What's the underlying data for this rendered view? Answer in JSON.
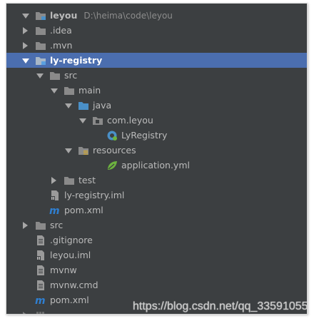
{
  "tree": {
    "rows": [
      {
        "label": "leyou",
        "path": "D:\\heima\\code\\leyou",
        "icon": "module-folder-icon",
        "arrow": "expanded",
        "bold": true
      },
      {
        "label": ".idea",
        "icon": "folder-icon",
        "arrow": "collapsed"
      },
      {
        "label": ".mvn",
        "icon": "folder-icon",
        "arrow": "collapsed"
      },
      {
        "label": "ly-registry",
        "icon": "module-folder-icon",
        "arrow": "expanded",
        "bold": true,
        "selected": true
      },
      {
        "label": "src",
        "icon": "folder-icon",
        "arrow": "expanded"
      },
      {
        "label": "main",
        "icon": "folder-icon",
        "arrow": "expanded"
      },
      {
        "label": "java",
        "icon": "source-folder-icon",
        "arrow": "expanded"
      },
      {
        "label": "com.leyou",
        "icon": "package-icon",
        "arrow": "expanded"
      },
      {
        "label": "LyRegistry",
        "icon": "spring-boot-class-icon",
        "arrow": "none"
      },
      {
        "label": "resources",
        "icon": "resources-folder-icon",
        "arrow": "expanded"
      },
      {
        "label": "application.yml",
        "icon": "spring-config-icon",
        "arrow": "none"
      },
      {
        "label": "test",
        "icon": "folder-icon",
        "arrow": "collapsed"
      },
      {
        "label": "ly-registry.iml",
        "icon": "iml-file-icon",
        "arrow": "none"
      },
      {
        "label": "pom.xml",
        "icon": "maven-icon",
        "arrow": "none"
      },
      {
        "label": "src",
        "icon": "folder-icon",
        "arrow": "collapsed"
      },
      {
        "label": ".gitignore",
        "icon": "text-file-icon",
        "arrow": "none"
      },
      {
        "label": "leyou.iml",
        "icon": "iml-file-icon",
        "arrow": "none"
      },
      {
        "label": "mvnw",
        "icon": "text-file-icon",
        "arrow": "none"
      },
      {
        "label": "mvnw.cmd",
        "icon": "text-file-icon",
        "arrow": "none"
      },
      {
        "label": "pom.xml",
        "icon": "maven-icon",
        "arrow": "none"
      }
    ]
  },
  "watermark": "https://blog.csdn.net/qq_33591055",
  "colors": {
    "background": "#3c3f41",
    "selection": "#4b6eaf",
    "text": "#bbbbbb",
    "folder": "#8a8a8a",
    "source_folder": "#4a90c8",
    "spring": "#6db33f",
    "maven": "#2f7fd1"
  }
}
